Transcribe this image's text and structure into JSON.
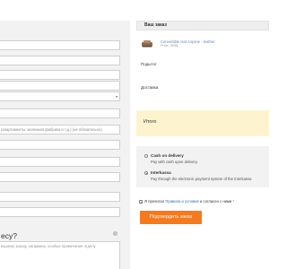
{
  "checkout_form": {
    "fields": [
      {
        "value": ""
      },
      {
        "value": ""
      },
      {
        "value": ""
      },
      {
        "value": ""
      },
      {
        "value": ""
      },
      {
        "value": ""
      },
      {
        "value": "(апартаменты, железная фабрика и т.д.) (не обязательно)"
      },
      {
        "value": ""
      },
      {
        "value": ""
      },
      {
        "value": ""
      },
      {
        "value": ""
      },
      {
        "value": ""
      }
    ],
    "question": "есу?",
    "comment_placeholder": "вашему заказу, например, особые примечания отделу"
  },
  "order_summary": {
    "title": "Ваш заказ",
    "product": {
      "name": "Convertible Hat Anyone - leather",
      "price": "Price: 999$"
    },
    "subtotal_label": "Подытог",
    "delivery_label": "Доставка",
    "total_label": "Итого"
  },
  "payment": {
    "methods": [
      {
        "title": "Cash on delivery",
        "description": "Pay with cash upon delivery.",
        "selected": false
      },
      {
        "title": "Interkassa",
        "description": "Pay through the electronic payment system of the Interkassa",
        "selected": true
      }
    ]
  },
  "terms": {
    "prefix": "Я прочитал",
    "link": "Правила и условия",
    "suffix": "и согласен с ними",
    "required_mark": "*",
    "checked": true,
    "checkmark": "✓"
  },
  "confirm_button_label": "Подтвердить заказ"
}
